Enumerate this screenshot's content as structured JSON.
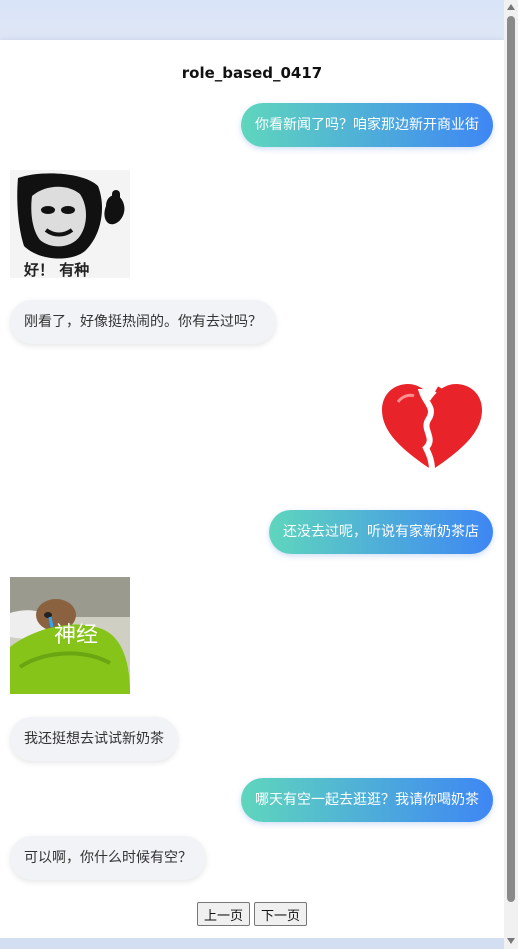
{
  "title": "role_based_0417",
  "messages": [
    {
      "side": "right",
      "text": "你看新闻了吗？咱家那边新开商业街"
    },
    {
      "side": "left",
      "sticker": "panda-face-sticker",
      "caption": "好！ 有种"
    },
    {
      "side": "left",
      "text": "刚看了，好像挺热闹的。你有去过吗？"
    },
    {
      "side": "right",
      "sticker": "broken-heart-sticker"
    },
    {
      "side": "right",
      "text": "还没去过呢，听说有家新奶茶店"
    },
    {
      "side": "left",
      "sticker": "dog-blanket-sticker",
      "caption": "神经"
    },
    {
      "side": "left",
      "text": "我还挺想去试试新奶茶"
    },
    {
      "side": "right",
      "text": "哪天有空一起去逛逛？我请你喝奶茶"
    },
    {
      "side": "left",
      "text": "可以啊，你什么时候有空？"
    }
  ],
  "pager": {
    "prev": "上一页",
    "next": "下一页"
  },
  "colors": {
    "bubble_right_start": "#5fd6bd",
    "bubble_right_end": "#3e86f4",
    "bubble_left": "#f1f3f7",
    "heart": "#e8232a"
  }
}
